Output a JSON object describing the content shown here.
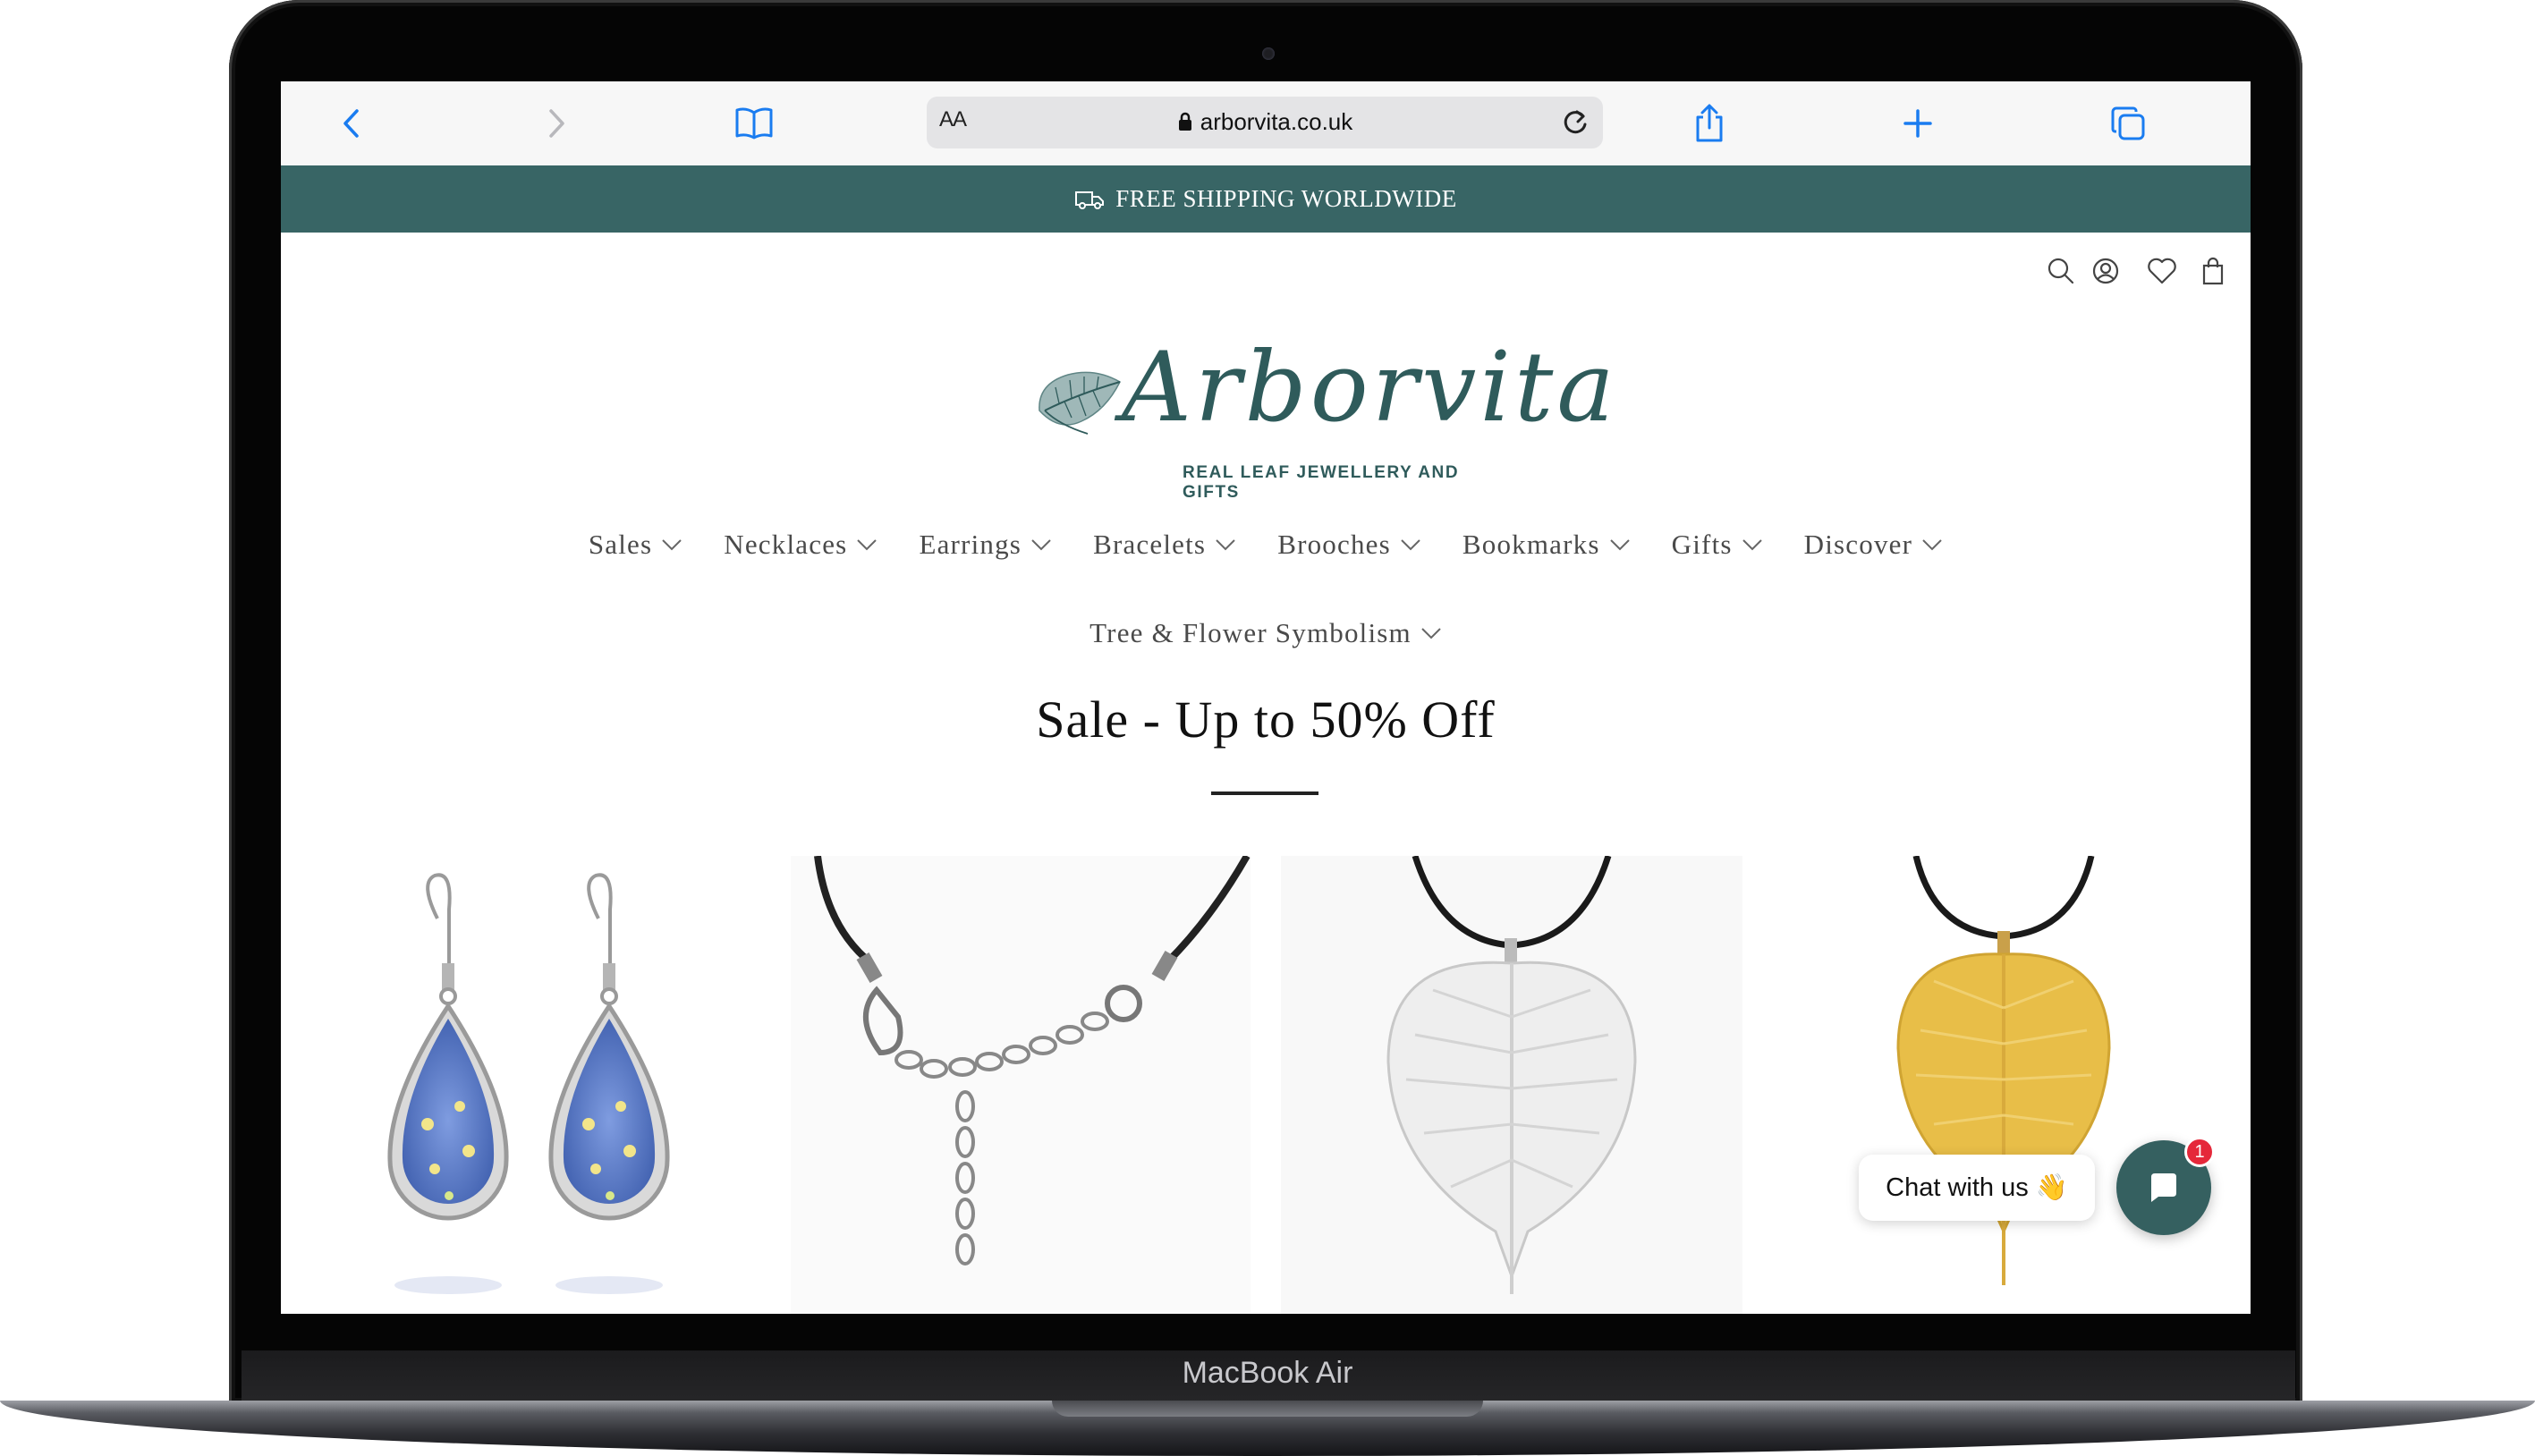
{
  "browser": {
    "aa_label": "AA",
    "url": "arborvita.co.uk",
    "toolbar_icons": [
      "back-icon",
      "forward-icon",
      "bookmarks-icon",
      "reload-icon",
      "share-icon",
      "new-tab-icon",
      "tabs-icon"
    ]
  },
  "announcement": {
    "text": "FREE SHIPPING WORLDWIDE",
    "icon": "truck-icon"
  },
  "header_icons": [
    "search-icon",
    "account-icon",
    "wishlist-icon",
    "cart-icon"
  ],
  "logo": {
    "wordmark": "Arborvita",
    "tagline": "REAL LEAF JEWELLERY AND GIFTS"
  },
  "nav": {
    "row1": [
      "Sales",
      "Necklaces",
      "Earrings",
      "Bracelets",
      "Brooches",
      "Bookmarks",
      "Gifts",
      "Discover"
    ],
    "row2": [
      "Tree & Flower Symbolism"
    ]
  },
  "main": {
    "title": "Sale - Up to 50% Off"
  },
  "products": [
    {
      "image": "blue-flower-teardrop-earrings"
    },
    {
      "image": "black-cord-extension-chain"
    },
    {
      "image": "silver-leaf-pendant"
    },
    {
      "image": "gold-leaf-pendant"
    }
  ],
  "chat": {
    "label": "Chat with us",
    "emoji": "👋",
    "badge": "1"
  },
  "device": {
    "model": "MacBook Air"
  },
  "colors": {
    "brand_teal": "#386565",
    "logo_teal": "#2f5b5b",
    "safari_blue": "#1a7cf0",
    "badge_red": "#e5283a"
  }
}
